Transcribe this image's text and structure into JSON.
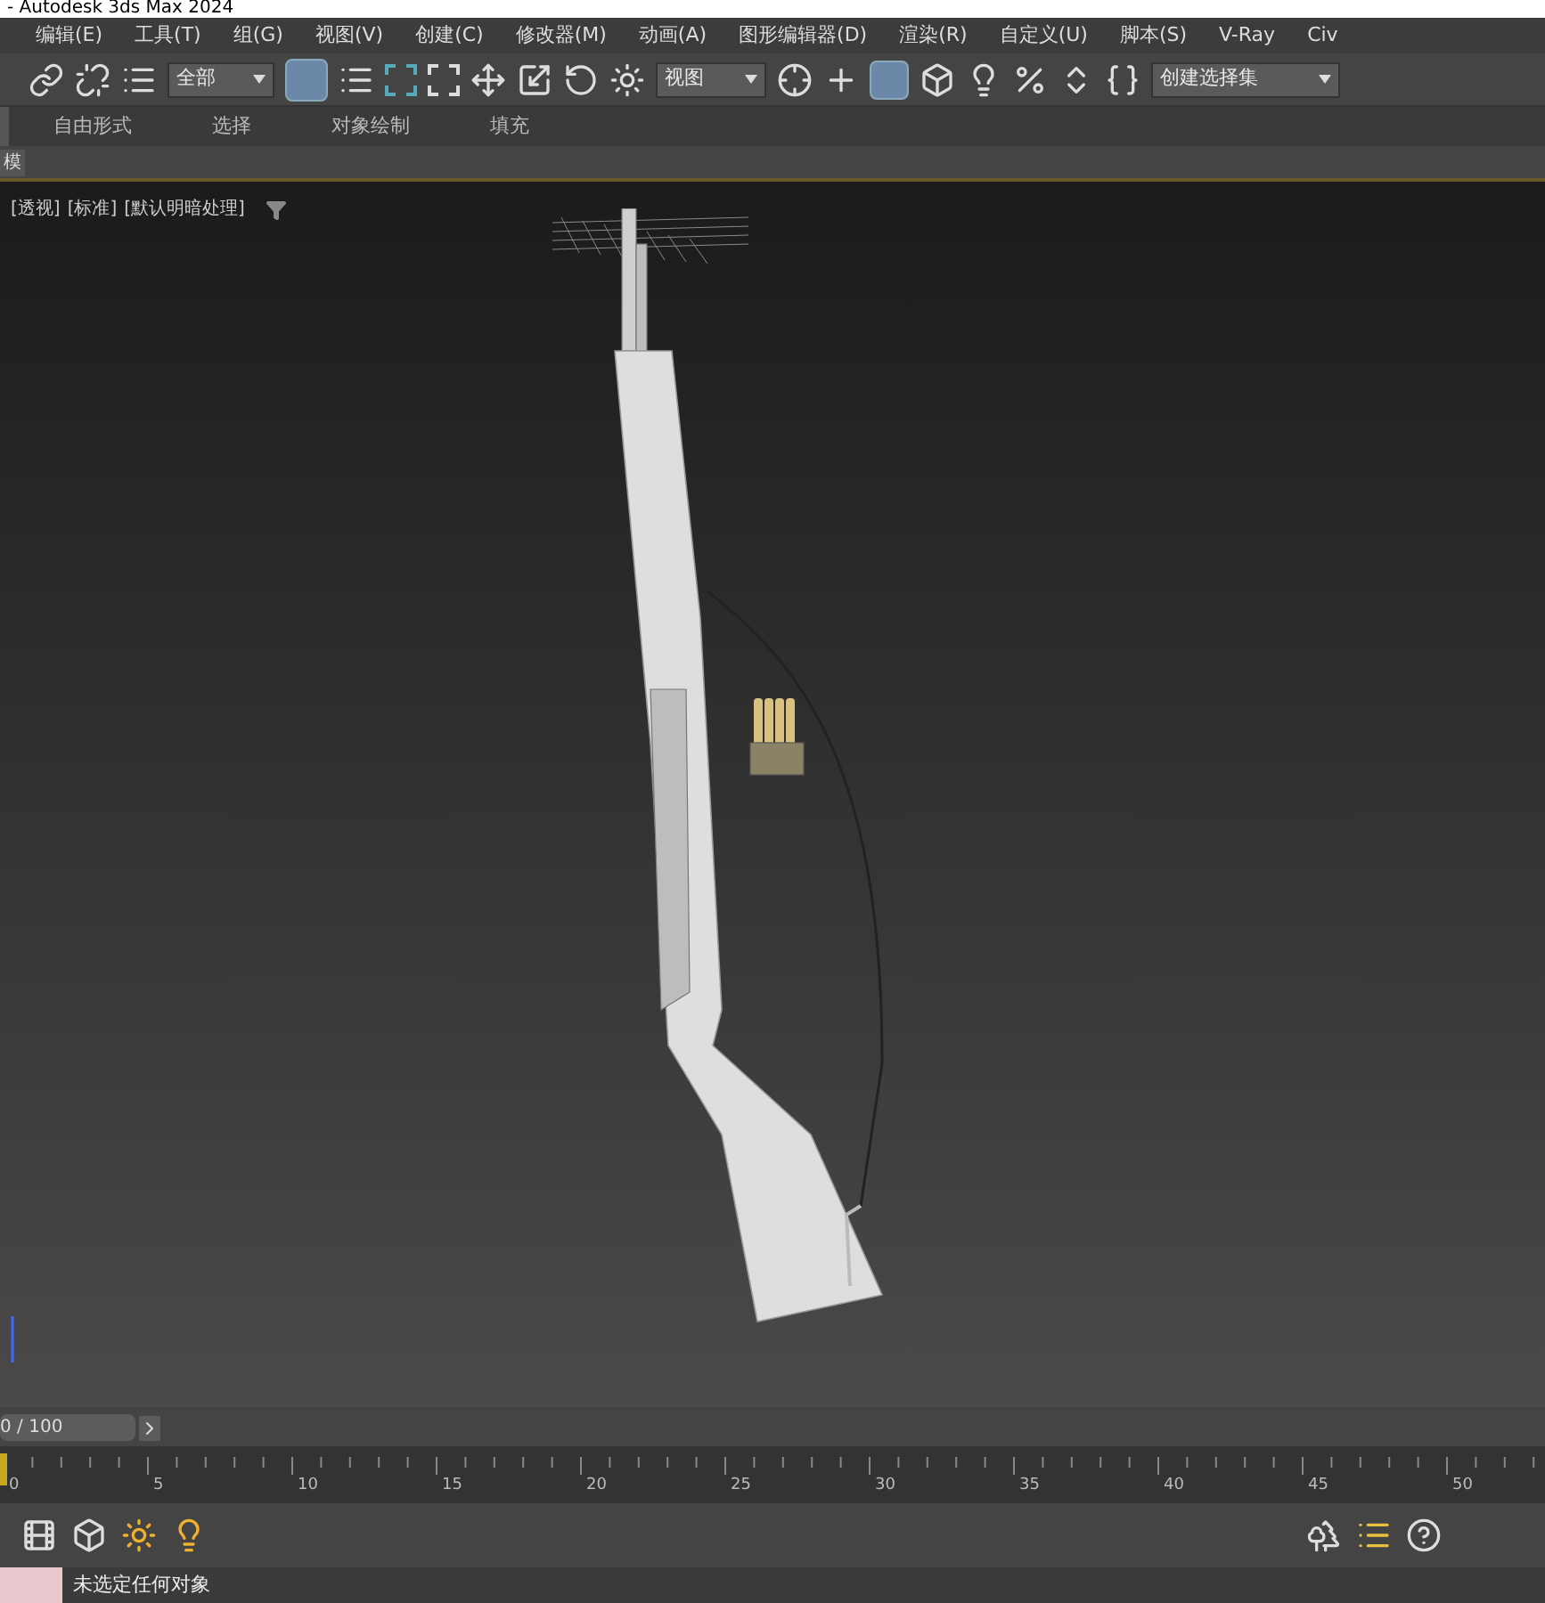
{
  "window": {
    "title": "- Autodesk 3ds Max 2024"
  },
  "menu": [
    "编辑(E)",
    "工具(T)",
    "组(G)",
    "视图(V)",
    "创建(C)",
    "修改器(M)",
    "动画(A)",
    "图形编辑器(D)",
    "渲染(R)",
    "自定义(U)",
    "脚本(S)",
    "V-Ray",
    "Civ"
  ],
  "toolbar": {
    "selection_filter": "全部",
    "reference_coord": "视图",
    "named_selection": "创建选择集"
  },
  "ribbon_tabs": [
    "自由形式",
    "选择",
    "对象绘制",
    "填充"
  ],
  "ribbon_panel_tab": "模",
  "viewport": {
    "labels": [
      "[透视]",
      "[标准]",
      "[默认明暗处理]"
    ]
  },
  "timeline": {
    "frame": "0 / 100",
    "level": 0,
    "ruler_labels": [
      "0",
      "5",
      "10",
      "15",
      "20",
      "25",
      "30",
      "35",
      "40",
      "45",
      "50"
    ]
  },
  "status_bar": {
    "message": "未选定任何对象"
  }
}
